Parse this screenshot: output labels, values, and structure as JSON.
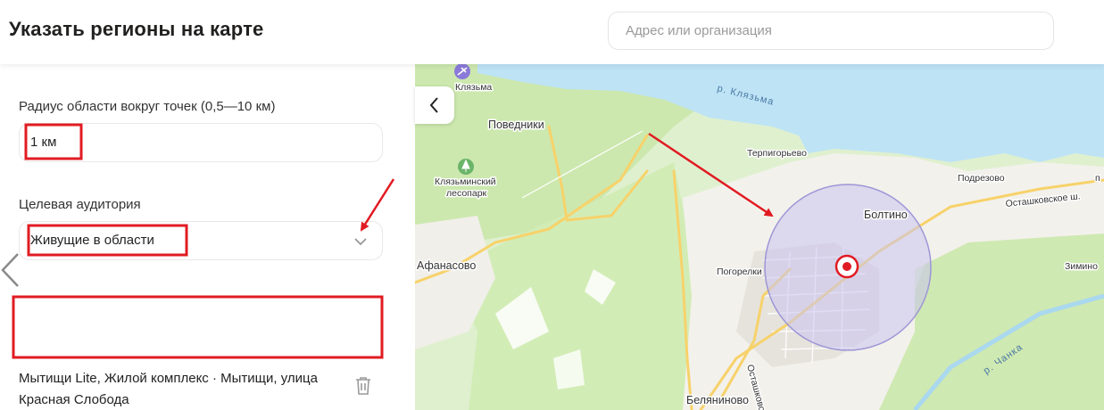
{
  "header": {
    "title": "Указать регионы на карте",
    "search_placeholder": "Адрес или организация"
  },
  "panel": {
    "radius_label": "Радиус области вокруг точек (0,5—10 км)",
    "radius_value": "1 км",
    "audience_label": "Целевая аудитория",
    "audience_value": "Живущие в области",
    "address": "Мытищи Lite, Жилой комплекс · Мытищи, улица Красная Слобода"
  },
  "map": {
    "places": {
      "klyazma_airport": "Клязьма",
      "povedniki": "Поведники",
      "klyazma_park": "Клязьминский",
      "klyazma_park_2": "лесопарк",
      "terpigorevo": "Терпигорьево",
      "podrezovo": "Подрезово",
      "ostashkovskoe_road": "Осташковское ш.",
      "boltino": "Болтино",
      "afanasovo": "Афанасово",
      "pogorelki": "Погорелки",
      "ziminо": "Зимино",
      "belyaninovo": "Беляниново",
      "ostashkovo_vertical": "Осташково",
      "river_chanka": "р. Чанка",
      "river_klyazma": "р. Клязьма",
      "edge_label": "п"
    }
  },
  "colors": {
    "accent_red": "#e11b22",
    "circle_fill": "#c9c3ef",
    "water": "#bde3f5",
    "forest": "#cdeab0",
    "road": "#f7d26a"
  },
  "icons": {
    "chevron": "chevron-down-icon",
    "trash": "trash-icon",
    "collapse": "chevron-left-icon",
    "side_marker": "triangle-left-icon",
    "target": "target-marker-icon",
    "park": "park-tree-icon",
    "airport": "airport-icon"
  }
}
